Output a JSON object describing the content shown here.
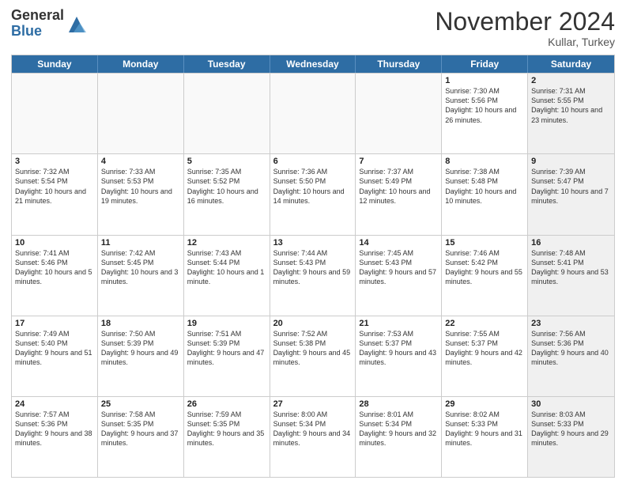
{
  "header": {
    "logo_general": "General",
    "logo_blue": "Blue",
    "month_title": "November 2024",
    "location": "Kullar, Turkey"
  },
  "weekdays": [
    "Sunday",
    "Monday",
    "Tuesday",
    "Wednesday",
    "Thursday",
    "Friday",
    "Saturday"
  ],
  "rows": [
    [
      {
        "day": "",
        "info": "",
        "empty": true
      },
      {
        "day": "",
        "info": "",
        "empty": true
      },
      {
        "day": "",
        "info": "",
        "empty": true
      },
      {
        "day": "",
        "info": "",
        "empty": true
      },
      {
        "day": "",
        "info": "",
        "empty": true
      },
      {
        "day": "1",
        "info": "Sunrise: 7:30 AM\nSunset: 5:56 PM\nDaylight: 10 hours and 26 minutes.",
        "empty": false,
        "shaded": false
      },
      {
        "day": "2",
        "info": "Sunrise: 7:31 AM\nSunset: 5:55 PM\nDaylight: 10 hours and 23 minutes.",
        "empty": false,
        "shaded": true
      }
    ],
    [
      {
        "day": "3",
        "info": "Sunrise: 7:32 AM\nSunset: 5:54 PM\nDaylight: 10 hours and 21 minutes.",
        "empty": false,
        "shaded": false
      },
      {
        "day": "4",
        "info": "Sunrise: 7:33 AM\nSunset: 5:53 PM\nDaylight: 10 hours and 19 minutes.",
        "empty": false,
        "shaded": false
      },
      {
        "day": "5",
        "info": "Sunrise: 7:35 AM\nSunset: 5:52 PM\nDaylight: 10 hours and 16 minutes.",
        "empty": false,
        "shaded": false
      },
      {
        "day": "6",
        "info": "Sunrise: 7:36 AM\nSunset: 5:50 PM\nDaylight: 10 hours and 14 minutes.",
        "empty": false,
        "shaded": false
      },
      {
        "day": "7",
        "info": "Sunrise: 7:37 AM\nSunset: 5:49 PM\nDaylight: 10 hours and 12 minutes.",
        "empty": false,
        "shaded": false
      },
      {
        "day": "8",
        "info": "Sunrise: 7:38 AM\nSunset: 5:48 PM\nDaylight: 10 hours and 10 minutes.",
        "empty": false,
        "shaded": false
      },
      {
        "day": "9",
        "info": "Sunrise: 7:39 AM\nSunset: 5:47 PM\nDaylight: 10 hours and 7 minutes.",
        "empty": false,
        "shaded": true
      }
    ],
    [
      {
        "day": "10",
        "info": "Sunrise: 7:41 AM\nSunset: 5:46 PM\nDaylight: 10 hours and 5 minutes.",
        "empty": false,
        "shaded": false
      },
      {
        "day": "11",
        "info": "Sunrise: 7:42 AM\nSunset: 5:45 PM\nDaylight: 10 hours and 3 minutes.",
        "empty": false,
        "shaded": false
      },
      {
        "day": "12",
        "info": "Sunrise: 7:43 AM\nSunset: 5:44 PM\nDaylight: 10 hours and 1 minute.",
        "empty": false,
        "shaded": false
      },
      {
        "day": "13",
        "info": "Sunrise: 7:44 AM\nSunset: 5:43 PM\nDaylight: 9 hours and 59 minutes.",
        "empty": false,
        "shaded": false
      },
      {
        "day": "14",
        "info": "Sunrise: 7:45 AM\nSunset: 5:43 PM\nDaylight: 9 hours and 57 minutes.",
        "empty": false,
        "shaded": false
      },
      {
        "day": "15",
        "info": "Sunrise: 7:46 AM\nSunset: 5:42 PM\nDaylight: 9 hours and 55 minutes.",
        "empty": false,
        "shaded": false
      },
      {
        "day": "16",
        "info": "Sunrise: 7:48 AM\nSunset: 5:41 PM\nDaylight: 9 hours and 53 minutes.",
        "empty": false,
        "shaded": true
      }
    ],
    [
      {
        "day": "17",
        "info": "Sunrise: 7:49 AM\nSunset: 5:40 PM\nDaylight: 9 hours and 51 minutes.",
        "empty": false,
        "shaded": false
      },
      {
        "day": "18",
        "info": "Sunrise: 7:50 AM\nSunset: 5:39 PM\nDaylight: 9 hours and 49 minutes.",
        "empty": false,
        "shaded": false
      },
      {
        "day": "19",
        "info": "Sunrise: 7:51 AM\nSunset: 5:39 PM\nDaylight: 9 hours and 47 minutes.",
        "empty": false,
        "shaded": false
      },
      {
        "day": "20",
        "info": "Sunrise: 7:52 AM\nSunset: 5:38 PM\nDaylight: 9 hours and 45 minutes.",
        "empty": false,
        "shaded": false
      },
      {
        "day": "21",
        "info": "Sunrise: 7:53 AM\nSunset: 5:37 PM\nDaylight: 9 hours and 43 minutes.",
        "empty": false,
        "shaded": false
      },
      {
        "day": "22",
        "info": "Sunrise: 7:55 AM\nSunset: 5:37 PM\nDaylight: 9 hours and 42 minutes.",
        "empty": false,
        "shaded": false
      },
      {
        "day": "23",
        "info": "Sunrise: 7:56 AM\nSunset: 5:36 PM\nDaylight: 9 hours and 40 minutes.",
        "empty": false,
        "shaded": true
      }
    ],
    [
      {
        "day": "24",
        "info": "Sunrise: 7:57 AM\nSunset: 5:36 PM\nDaylight: 9 hours and 38 minutes.",
        "empty": false,
        "shaded": false
      },
      {
        "day": "25",
        "info": "Sunrise: 7:58 AM\nSunset: 5:35 PM\nDaylight: 9 hours and 37 minutes.",
        "empty": false,
        "shaded": false
      },
      {
        "day": "26",
        "info": "Sunrise: 7:59 AM\nSunset: 5:35 PM\nDaylight: 9 hours and 35 minutes.",
        "empty": false,
        "shaded": false
      },
      {
        "day": "27",
        "info": "Sunrise: 8:00 AM\nSunset: 5:34 PM\nDaylight: 9 hours and 34 minutes.",
        "empty": false,
        "shaded": false
      },
      {
        "day": "28",
        "info": "Sunrise: 8:01 AM\nSunset: 5:34 PM\nDaylight: 9 hours and 32 minutes.",
        "empty": false,
        "shaded": false
      },
      {
        "day": "29",
        "info": "Sunrise: 8:02 AM\nSunset: 5:33 PM\nDaylight: 9 hours and 31 minutes.",
        "empty": false,
        "shaded": false
      },
      {
        "day": "30",
        "info": "Sunrise: 8:03 AM\nSunset: 5:33 PM\nDaylight: 9 hours and 29 minutes.",
        "empty": false,
        "shaded": true
      }
    ]
  ]
}
